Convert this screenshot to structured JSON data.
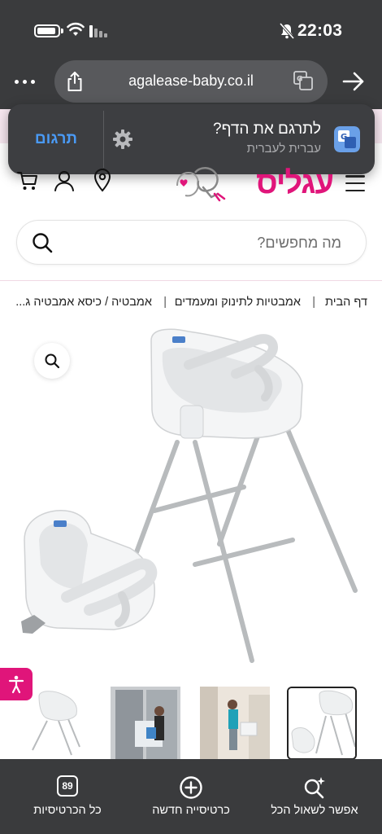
{
  "status_bar": {
    "time": "22:03",
    "icons": [
      "battery-icon",
      "wifi-icon",
      "signal-icon",
      "bell-muted-icon"
    ]
  },
  "browser": {
    "url": "agalease-baby.co.il",
    "icons": [
      "more-icon",
      "share-icon",
      "translate-icon",
      "forward-arrow-icon"
    ]
  },
  "translate_popup": {
    "title": "לתרגם את הדף?",
    "subtitle": "עברית לעברית",
    "translate_button": "תרגום",
    "icons": [
      "gear-icon",
      "google-translate-icon"
    ]
  },
  "site": {
    "logo_text": "עגליס",
    "icons": [
      "cart-icon",
      "user-icon",
      "location-pin-icon",
      "hamburger-menu-icon"
    ],
    "brand_color": "#e0157a"
  },
  "search": {
    "placeholder": "מה מחפשים?"
  },
  "breadcrumb": {
    "items": [
      "דף הבית",
      "אמבטיות לתינוק ומעמדים",
      "אמבטיה / כיסא אמבטיה ג..."
    ]
  },
  "product": {
    "icons": [
      "zoom-icon",
      "accessibility-icon"
    ]
  },
  "thumbnails": {
    "count": 4,
    "active_index": 0
  },
  "toolbar": {
    "items": [
      {
        "label": "אפשר לשאול הכל",
        "icon": "search-sparkle-icon"
      },
      {
        "label": "כרטיסייה חדשה",
        "icon": "plus-circle-icon"
      },
      {
        "label": "כל הכרטיסיות",
        "icon": "tabs-icon",
        "count": "89"
      }
    ]
  }
}
